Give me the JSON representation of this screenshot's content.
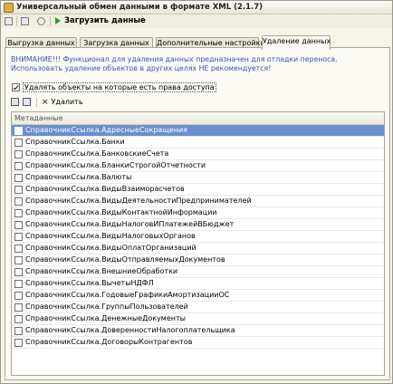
{
  "window": {
    "title": "Универсальный обмен данными в формате XML (2.1.7)"
  },
  "toolbar": {
    "load_label": "Загрузить данные"
  },
  "tabs": [
    {
      "label": "Выгрузка данных",
      "active": false
    },
    {
      "label": "Загрузка данных",
      "active": false
    },
    {
      "label": "Дополнительные настройки",
      "active": false
    },
    {
      "label": "Удаление данных",
      "active": true
    }
  ],
  "warning": "ВНИМАНИЕ!!! Функционал для удаления данных предназначен для отладки переноса. Использовать удаление объектов в других целях НЕ рекомендуется!",
  "access_checkbox": {
    "label": "Удалять объекты на которые есть права доступа",
    "checked": true
  },
  "subtoolbar": {
    "delete_label": "Удалить"
  },
  "grid": {
    "column_header": "Метаданные",
    "rows": [
      "СправочникСсылка.АдресныеСокращения",
      "СправочникСсылка.Банки",
      "СправочникСсылка.БанковскиеСчета",
      "СправочникСсылка.БланкиСтрогойОтчетности",
      "СправочникСсылка.Валюты",
      "СправочникСсылка.ВидыВзаиморасчетов",
      "СправочникСсылка.ВидыДеятельностиПредпринимателей",
      "СправочникСсылка.ВидыКонтактнойИнформации",
      "СправочникСсылка.ВидыНалоговИПлатежейВБюджет",
      "СправочникСсылка.ВидыНалоговыхОрганов",
      "СправочникСсылка.ВидыОплатОрганизаций",
      "СправочникСсылка.ВидыОтправляемыхДокументов",
      "СправочникСсылка.ВнешниеОбработки",
      "СправочникСсылка.ВычетыНДФЛ",
      "СправочникСсылка.ГодовыеГрафикиАмортизацииОС",
      "СправочникСсылка.ГруппыПользователей",
      "СправочникСсылка.ДенежныеДокументы",
      "СправочникСсылка.ДоверенностиНалогоплательщика",
      "СправочникСсылка.ДоговорыКонтрагентов"
    ],
    "selected_index": 0
  }
}
